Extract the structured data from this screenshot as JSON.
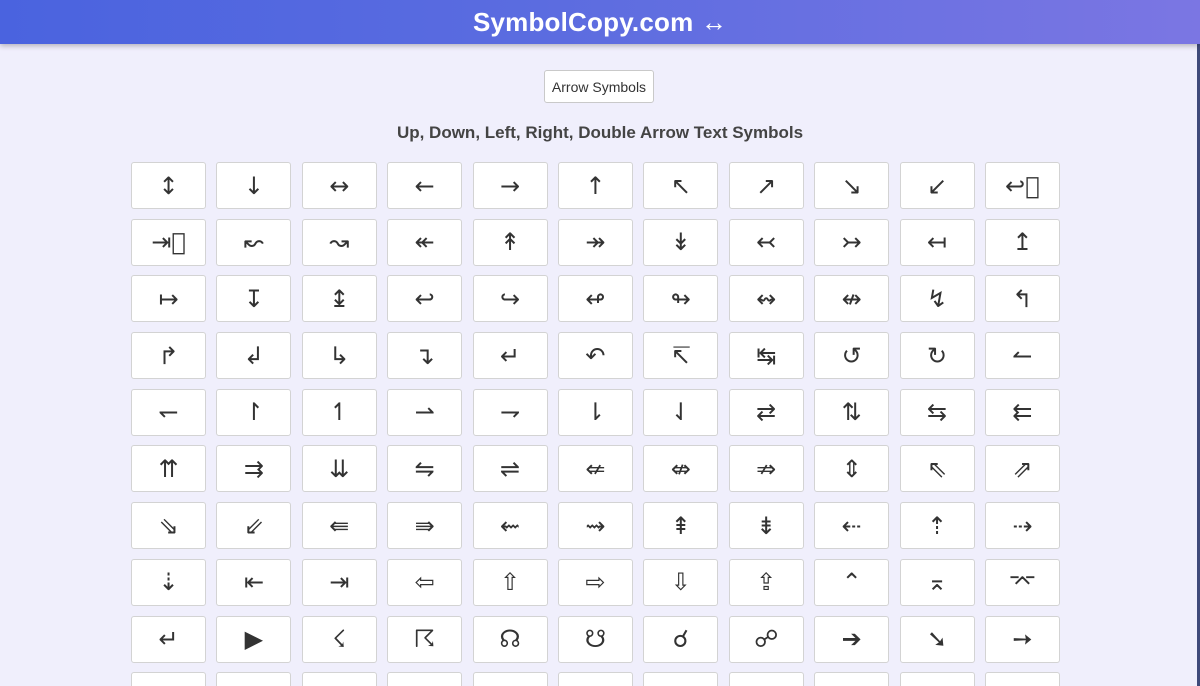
{
  "header": {
    "title": "SymbolCopy.com ↔"
  },
  "category_button": {
    "label": "Arrow Symbols"
  },
  "section": {
    "heading": "Up, Down, Left, Right, Double Arrow Text Symbols"
  },
  "symbols": [
    "↕",
    "↓",
    "↔",
    "←",
    "→",
    "↑",
    "↖",
    "↗",
    "↘",
    "↙",
    "↩⃥",
    "⇥⃥",
    "↜",
    "↝",
    "↞",
    "↟",
    "↠",
    "↡",
    "↢",
    "↣",
    "↤",
    "↥",
    "↦",
    "↧",
    "↨",
    "↩",
    "↪",
    "↫",
    "↬",
    "↭",
    "↮",
    "↯",
    "↰",
    "↱",
    "↲",
    "↳",
    "↴",
    "↵",
    "↶",
    "↸",
    "↹",
    "↺",
    "↻",
    "↼",
    "↽",
    "↾",
    "↿",
    "⇀",
    "⇁",
    "⇂",
    "⇃",
    "⇄",
    "⇅",
    "⇆",
    "⇇",
    "⇈",
    "⇉",
    "⇊",
    "⇋",
    "⇌",
    "⇍",
    "⇎",
    "⇏",
    "⇕",
    "⇖",
    "⇗",
    "⇘",
    "⇙",
    "⇚",
    "⇛",
    "⇜",
    "⇝",
    "⇞",
    "⇟",
    "⇠",
    "⇡",
    "⇢",
    "⇣",
    "⇤",
    "⇥",
    "⇦",
    "⇧",
    "⇨",
    "⇩",
    "⇪",
    "⌃",
    "⌅",
    "⌤",
    "↵",
    "▶",
    "☇",
    "☈",
    "☊",
    "☋",
    "☌",
    "☍",
    "➔",
    "➘",
    "➙",
    "",
    "",
    "",
    "",
    "",
    "",
    "",
    "",
    "",
    "",
    ""
  ]
}
